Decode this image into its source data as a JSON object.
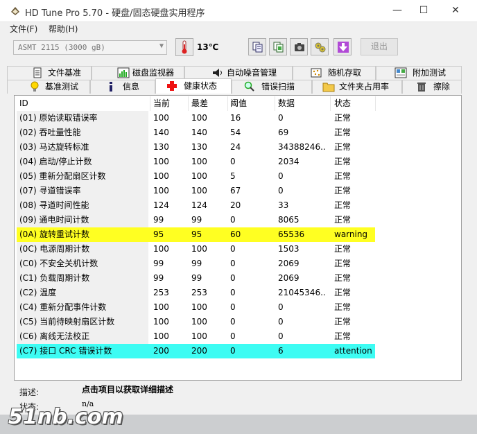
{
  "window": {
    "title": "HD Tune Pro 5.70 - 硬盘/固态硬盘实用程序"
  },
  "menu": [
    "文件(F)",
    "帮助(H)"
  ],
  "toolbar": {
    "drive": "ASMT    2115 (3000 gB)",
    "temperature": "13℃",
    "exit_label": "退出"
  },
  "tabs_row1": [
    {
      "label": "文件基准",
      "icon": "file-benchmark-icon"
    },
    {
      "label": "磁盘监视器",
      "icon": "disk-monitor-icon"
    },
    {
      "label": "自动噪音管理",
      "icon": "speaker-icon"
    },
    {
      "label": "随机存取",
      "icon": "random-access-icon"
    },
    {
      "label": "附加测试",
      "icon": "extra-tests-icon"
    }
  ],
  "tabs_row2": [
    {
      "label": "基准测试",
      "icon": "bulb-icon"
    },
    {
      "label": "信息",
      "icon": "info-icon"
    },
    {
      "label": "健康状态",
      "icon": "health-cross-icon"
    },
    {
      "label": "错误扫描",
      "icon": "magnifier-icon"
    },
    {
      "label": "文件夹占用率",
      "icon": "folder-icon"
    },
    {
      "label": "擦除",
      "icon": "trash-icon"
    }
  ],
  "columns": [
    "ID",
    "当前",
    "最差",
    "阈值",
    "数据",
    "状态"
  ],
  "rows": [
    {
      "id": "(01) 原始读取错误率",
      "cur": "100",
      "worst": "100",
      "thr": "16",
      "data": "0",
      "status": "正常"
    },
    {
      "id": "(02) 吞吐量性能",
      "cur": "140",
      "worst": "140",
      "thr": "54",
      "data": "69",
      "status": "正常"
    },
    {
      "id": "(03) 马达旋转标准",
      "cur": "130",
      "worst": "130",
      "thr": "24",
      "data": "34388246...",
      "status": "正常"
    },
    {
      "id": "(04) 启动/停止计数",
      "cur": "100",
      "worst": "100",
      "thr": "0",
      "data": "2034",
      "status": "正常"
    },
    {
      "id": "(05) 重新分配扇区计数",
      "cur": "100",
      "worst": "100",
      "thr": "5",
      "data": "0",
      "status": "正常"
    },
    {
      "id": "(07) 寻道错误率",
      "cur": "100",
      "worst": "100",
      "thr": "67",
      "data": "0",
      "status": "正常"
    },
    {
      "id": "(08) 寻道时间性能",
      "cur": "124",
      "worst": "124",
      "thr": "20",
      "data": "33",
      "status": "正常"
    },
    {
      "id": "(09) 通电时间计数",
      "cur": "99",
      "worst": "99",
      "thr": "0",
      "data": "8065",
      "status": "正常"
    },
    {
      "id": "(0A) 旋转重试计数",
      "cur": "95",
      "worst": "95",
      "thr": "60",
      "data": "65536",
      "status": "warning",
      "highlight": "#ffff22"
    },
    {
      "id": "(0C) 电源周期计数",
      "cur": "100",
      "worst": "100",
      "thr": "0",
      "data": "1503",
      "status": "正常"
    },
    {
      "id": "(C0) 不安全关机计数",
      "cur": "99",
      "worst": "99",
      "thr": "0",
      "data": "2069",
      "status": "正常"
    },
    {
      "id": "(C1) 负载周期计数",
      "cur": "99",
      "worst": "99",
      "thr": "0",
      "data": "2069",
      "status": "正常"
    },
    {
      "id": "(C2) 温度",
      "cur": "253",
      "worst": "253",
      "thr": "0",
      "data": "21045346...",
      "status": "正常"
    },
    {
      "id": "(C4) 重新分配事件计数",
      "cur": "100",
      "worst": "100",
      "thr": "0",
      "data": "0",
      "status": "正常"
    },
    {
      "id": "(C5) 当前待映射扇区计数",
      "cur": "100",
      "worst": "100",
      "thr": "0",
      "data": "0",
      "status": "正常"
    },
    {
      "id": "(C6) 离线无法校正",
      "cur": "100",
      "worst": "100",
      "thr": "0",
      "data": "0",
      "status": "正常"
    },
    {
      "id": "(C7) 接口 CRC 错误计数",
      "cur": "200",
      "worst": "200",
      "thr": "0",
      "data": "6",
      "status": "attention",
      "highlight": "#3dfcf3"
    }
  ],
  "footer": {
    "desc_label": "描述:",
    "desc_value": "点击项目以获取详细描述",
    "status_label": "状态:",
    "status_value": "n/a"
  },
  "watermark": "51nb.com"
}
